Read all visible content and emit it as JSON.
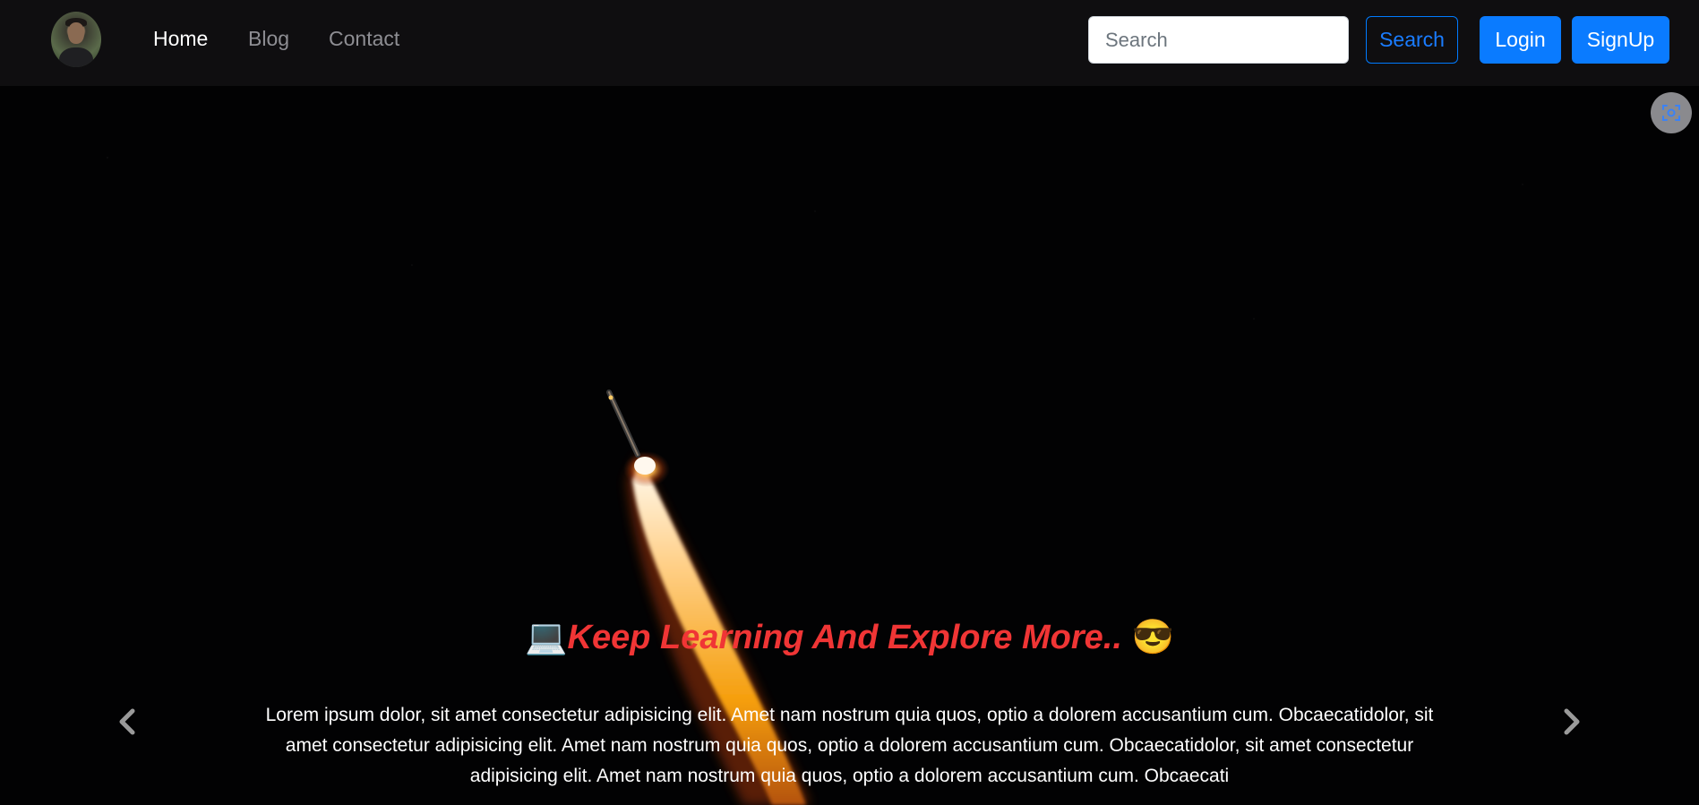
{
  "navbar": {
    "links": [
      {
        "label": "Home",
        "active": true
      },
      {
        "label": "Blog",
        "active": false
      },
      {
        "label": "Contact",
        "active": false
      }
    ],
    "search": {
      "placeholder": "Search",
      "button_label": "Search"
    },
    "login_label": "Login",
    "signup_label": "SignUp"
  },
  "carousel": {
    "caption_title": "Keep Learning And Explore More..",
    "title_emoji_left": "💻",
    "title_emoji_right": "😎",
    "caption_text": "Lorem ipsum dolor, sit amet consectetur adipisicing elit. Amet nam nostrum quia quos, optio a dolorem accusantium cum. Obcaecatidolor, sit amet consectetur adipisicing elit. Amet nam nostrum quia quos, optio a dolorem accusantium cum. Obcaecatidolor, sit amet consectetur adipisicing elit. Amet nam nostrum quia quos, optio a dolorem accusantium cum. Obcaecati"
  },
  "colors": {
    "navbar_bg": "#0f0e10",
    "primary": "#0a7bff",
    "title_red": "#f03535",
    "hero_bg": "#020203"
  },
  "icons": {
    "prev": "chevron-left-icon",
    "next": "chevron-right-icon",
    "screenshot": "screenshot-capture-icon"
  }
}
